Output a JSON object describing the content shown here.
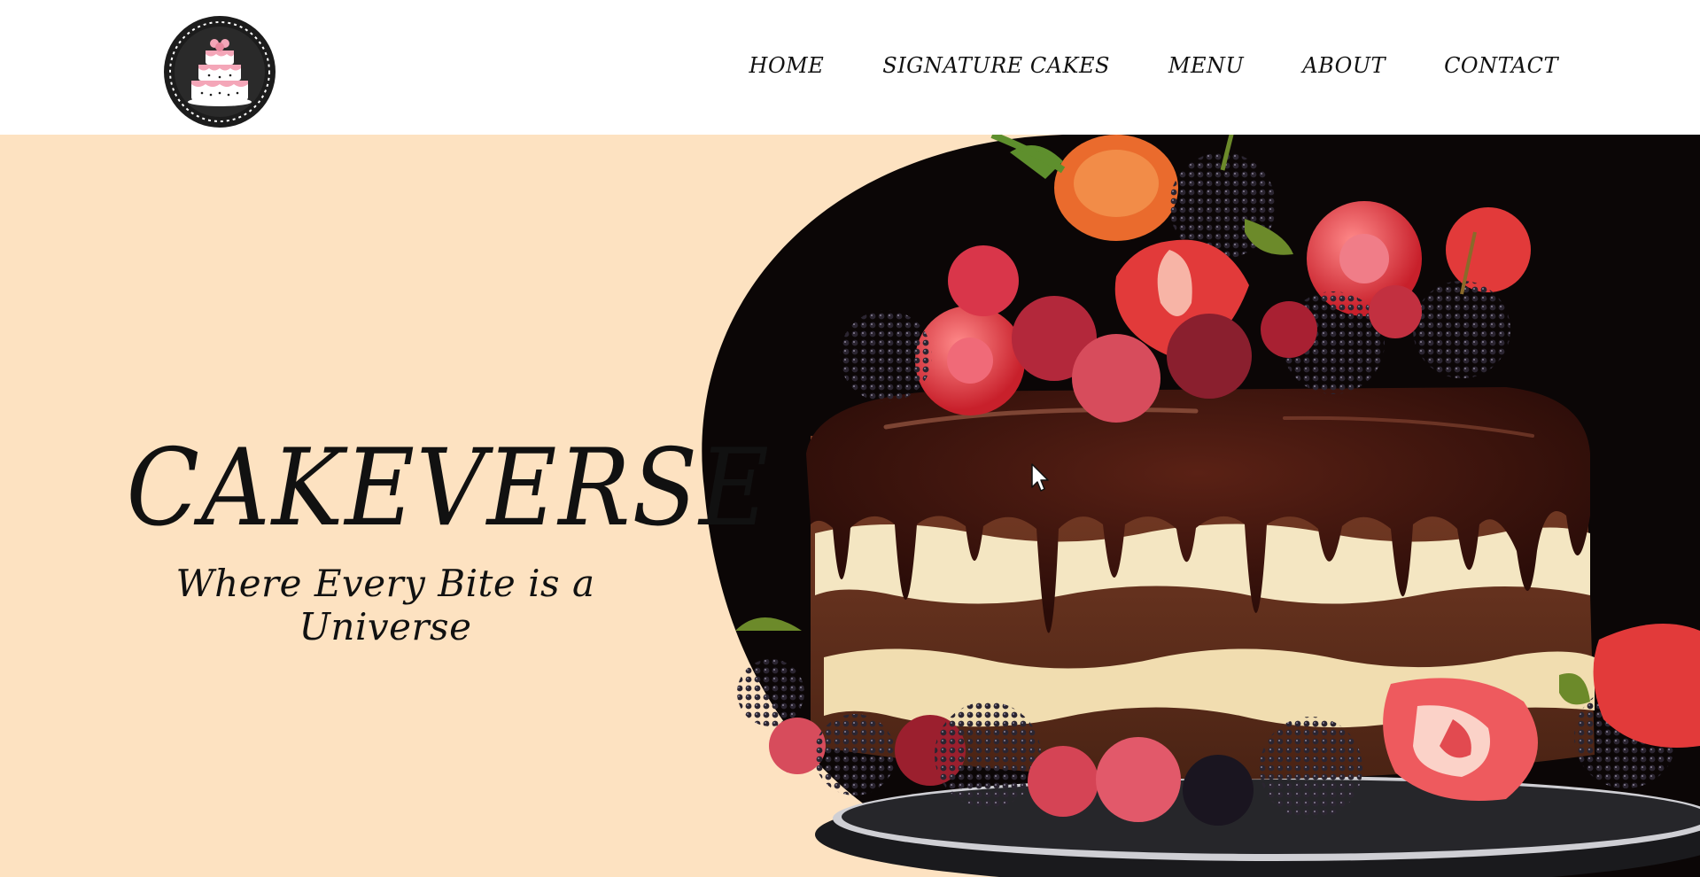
{
  "header": {
    "logo": {
      "icon": "layer-cake-icon",
      "colors": {
        "badge": "#1c1c1c",
        "cake_pink": "#f4a6b8",
        "cake_cream": "#ffffff"
      }
    },
    "nav": [
      {
        "label": "HOME"
      },
      {
        "label": "SIGNATURE CAKES"
      },
      {
        "label": "MENU"
      },
      {
        "label": "ABOUT"
      },
      {
        "label": "CONTACT"
      }
    ]
  },
  "hero": {
    "title": "CAKEVERSE",
    "tagline": "Where Every Bite is a Universe",
    "image": {
      "subject": "chocolate-drip-cake-with-berries-image"
    },
    "colors": {
      "background": "#fde2c1",
      "image_backdrop": "#0b0606",
      "chocolate": "#3a130d",
      "cream": "#f4e6c2",
      "strawberry": "#e23a3a",
      "raspberry": "#e85a6a",
      "blackberry": "#18131c"
    }
  }
}
